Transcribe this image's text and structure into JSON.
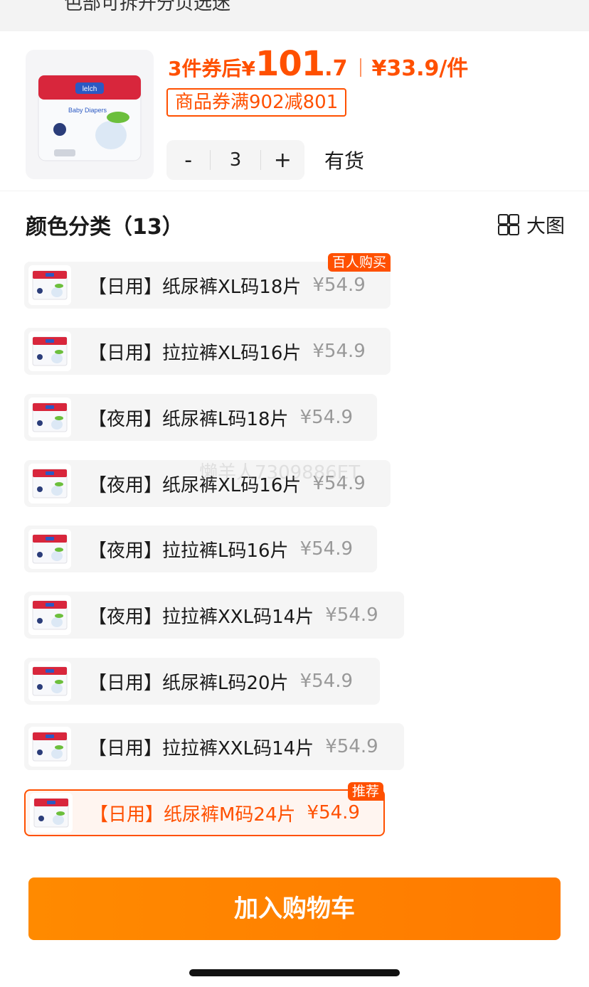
{
  "top_cut_text": "色部可拆开分页选迷",
  "product": {
    "price_prefix": "3件券后",
    "currency": "¥",
    "price_int": "101",
    "price_dec": ".7",
    "unit_price": "¥33.9/件",
    "coupon": "商品券满902减801",
    "qty_minus": "-",
    "qty_value": "3",
    "qty_plus": "+",
    "stock": "有货"
  },
  "section": {
    "title": "颜色分类（13）",
    "big_image_label": "大图"
  },
  "watermark": "懒羊人7309886ET",
  "options": [
    {
      "name": "【日用】纸尿裤XL码18片",
      "price": "¥54.9",
      "badge": "百人购买"
    },
    {
      "name": "【日用】拉拉裤XL码16片",
      "price": "¥54.9",
      "badge": ""
    },
    {
      "name": "【夜用】纸尿裤L码18片",
      "price": "¥54.9",
      "badge": ""
    },
    {
      "name": "【夜用】纸尿裤XL码16片",
      "price": "¥54.9",
      "badge": ""
    },
    {
      "name": "【夜用】拉拉裤L码16片",
      "price": "¥54.9",
      "badge": ""
    },
    {
      "name": "【夜用】拉拉裤XXL码14片",
      "price": "¥54.9",
      "badge": ""
    },
    {
      "name": "【日用】纸尿裤L码20片",
      "price": "¥54.9",
      "badge": ""
    },
    {
      "name": "【日用】拉拉裤XXL码14片",
      "price": "¥54.9",
      "badge": ""
    },
    {
      "name": "【日用】纸尿裤M码24片",
      "price": "¥54.9",
      "badge": "推荐",
      "selected": true
    }
  ],
  "cart_button": "加入购物车",
  "colors": {
    "accent": "#ff5000",
    "button": "#ff8000"
  }
}
